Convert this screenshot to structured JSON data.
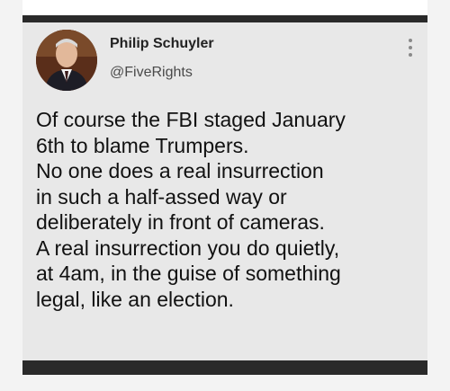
{
  "tweet": {
    "author_name": "Philip Schuyler",
    "author_handle": "@FiveRights",
    "text": "Of course the FBI staged January\n6th to blame Trumpers.\nNo one does a real insurrection\nin such a half-assed way or\ndeliberately in front of cameras.\nA real insurrection you do quietly,\nat 4am, in the guise of something\nlegal, like an election.",
    "icons": {
      "more": "more-vertical-icon",
      "avatar": "profile-photo"
    }
  }
}
